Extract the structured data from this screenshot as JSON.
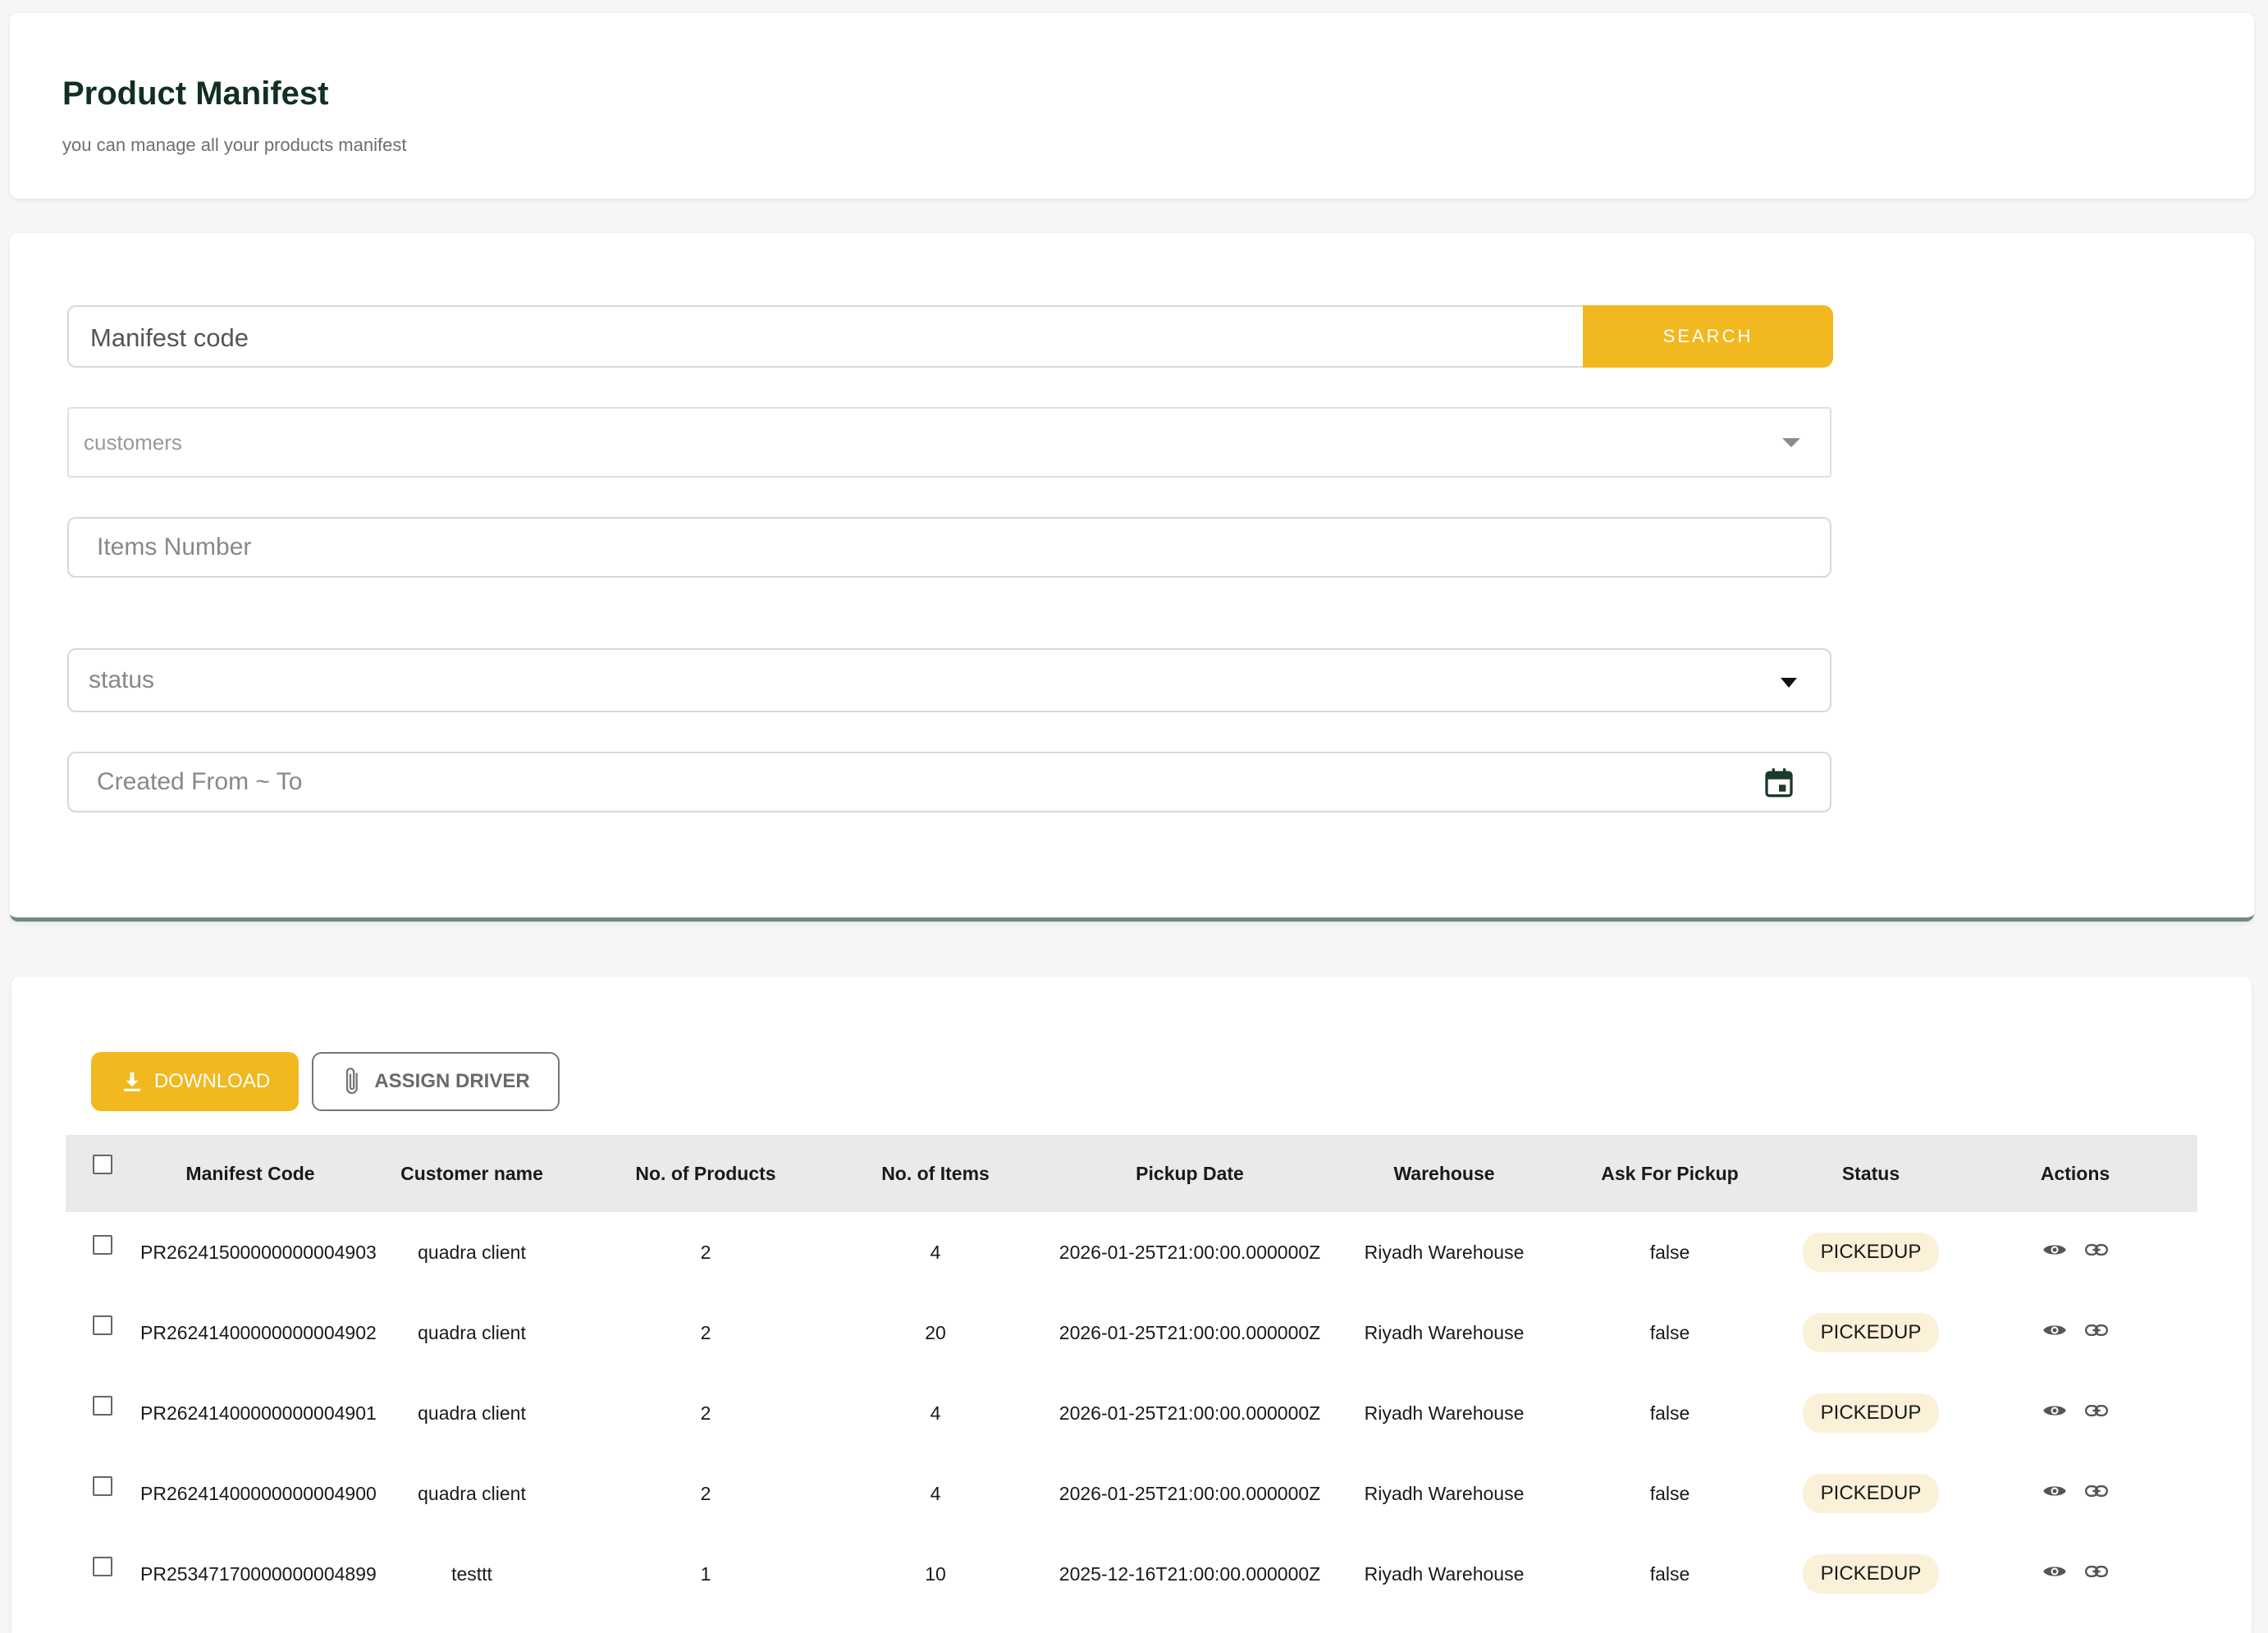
{
  "header": {
    "title": "Product Manifest",
    "subtitle": "you can manage all your products manifest"
  },
  "filters": {
    "manifest_code_placeholder": "Manifest code",
    "search_label": "SEARCH",
    "customers_placeholder": "customers",
    "items_number_placeholder": "Items Number",
    "status_placeholder": "status",
    "created_range_placeholder": "Created From ~ To"
  },
  "toolbar": {
    "download_label": "DOWNLOAD",
    "assign_driver_label": "ASSIGN DRIVER"
  },
  "table": {
    "columns": [
      "Manifest Code",
      "Customer name",
      "No. of Products",
      "No. of Items",
      "Pickup Date",
      "Warehouse",
      "Ask For Pickup",
      "Status",
      "Actions"
    ],
    "rows": [
      {
        "code": "PR26241500000000004903",
        "customer": "quadra client",
        "products": "2",
        "items": "4",
        "pickup_date": "2026-01-25T21:00:00.000000Z",
        "warehouse": "Riyadh Warehouse",
        "ask_pickup": "false",
        "status": "PICKEDUP"
      },
      {
        "code": "PR26241400000000004902",
        "customer": "quadra client",
        "products": "2",
        "items": "20",
        "pickup_date": "2026-01-25T21:00:00.000000Z",
        "warehouse": "Riyadh Warehouse",
        "ask_pickup": "false",
        "status": "PICKEDUP"
      },
      {
        "code": "PR26241400000000004901",
        "customer": "quadra client",
        "products": "2",
        "items": "4",
        "pickup_date": "2026-01-25T21:00:00.000000Z",
        "warehouse": "Riyadh Warehouse",
        "ask_pickup": "false",
        "status": "PICKEDUP"
      },
      {
        "code": "PR26241400000000004900",
        "customer": "quadra client",
        "products": "2",
        "items": "4",
        "pickup_date": "2026-01-25T21:00:00.000000Z",
        "warehouse": "Riyadh Warehouse",
        "ask_pickup": "false",
        "status": "PICKEDUP"
      },
      {
        "code": "PR25347170000000004899",
        "customer": "testtt",
        "products": "1",
        "items": "10",
        "pickup_date": "2025-12-16T21:00:00.000000Z",
        "warehouse": "Riyadh Warehouse",
        "ask_pickup": "false",
        "status": "PICKEDUP"
      }
    ]
  },
  "icons": {
    "view": "eye-icon",
    "link": "link-icon",
    "download": "download-icon",
    "attach": "paperclip-icon",
    "calendar": "calendar-icon"
  },
  "colors": {
    "accent": "#f2b81f",
    "title": "#11301f",
    "badge_bg": "#fbf1d9",
    "filter_card_border": "#6e8b80"
  }
}
